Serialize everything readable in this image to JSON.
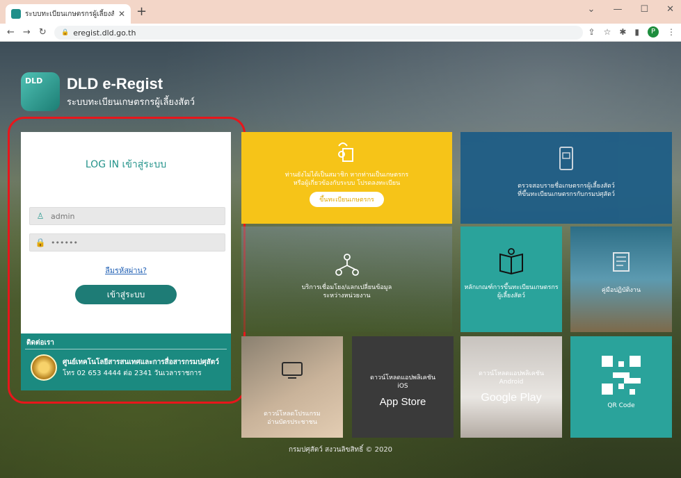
{
  "browser": {
    "tab_title": "ระบบทะเบียนเกษตรกรผู้เลี้ยงสัตว์",
    "url": "eregist.dld.go.th",
    "profile_initial": "P"
  },
  "brand": {
    "logo_badge": "DLD",
    "title": "DLD e-Regist",
    "subtitle": "ระบบทะเบียนเกษตรกรผู้เลี้ยงสัตว์"
  },
  "login": {
    "title": "LOG IN เข้าสู่ระบบ",
    "username_value": "admin",
    "password_value": "••••••",
    "forgot_label": "ลืมรหัสผ่าน?",
    "submit_label": "เข้าสู่ระบบ"
  },
  "contact": {
    "heading": "ติดต่อเรา",
    "org": "ศูนย์เทคโนโลยีสารสนเทศและการสื่อสารกรมปศุสัตว์",
    "phone": "โทร 02 653 4444 ต่อ 2341 วันเวลาราชการ"
  },
  "tiles": {
    "register_line1": "ท่านยังไม่ได้เป็นสมาชิก หากท่านเป็นเกษตรกร",
    "register_line2": "หรือผู้เกี่ยวข้องกับระบบ โปรดลงทะเบียน",
    "register_button": "ขึ้นทะเบียนเกษตรกร",
    "check_line1": "ตรวจสอบรายชื่อเกษตรกรผู้เลี้ยงสัตว์",
    "check_line2": "ที่ขึ้นทะเบียนเกษตรกรกับกรมปศุสัตว์",
    "exchange_line1": "บริการเชื่อมโยง/แลกเปลี่ยนข้อมูล",
    "exchange_line2": "ระหว่างหน่วยงาน",
    "criteria_line1": "หลักเกณฑ์การขึ้นทะเบียนเกษตรกร",
    "criteria_line2": "ผู้เลี้ยงสัตว์",
    "manual": "คู่มือปฏิบัติงาน",
    "cardreader_line1": "ดาวน์โหลดโปรแกรม",
    "cardreader_line2": "อ่านบัตรประชาชน",
    "ios_line1": "ดาวน์โหลดแอปพลิเคชัน",
    "ios_line2": "iOS",
    "ios_store": "App Store",
    "android_line1": "ดาวน์โหลดแอปพลิเคชัน",
    "android_line2": "Android",
    "android_store": "Google Play",
    "qr": "QR Code"
  },
  "footer": "กรมปศุสัตว์ สงวนลิขสิทธิ์ © 2020",
  "colors": {
    "teal": "#2aa39b",
    "yellow": "#f6c418",
    "blue": "#1e5d86",
    "highlight": "#e8161b"
  }
}
